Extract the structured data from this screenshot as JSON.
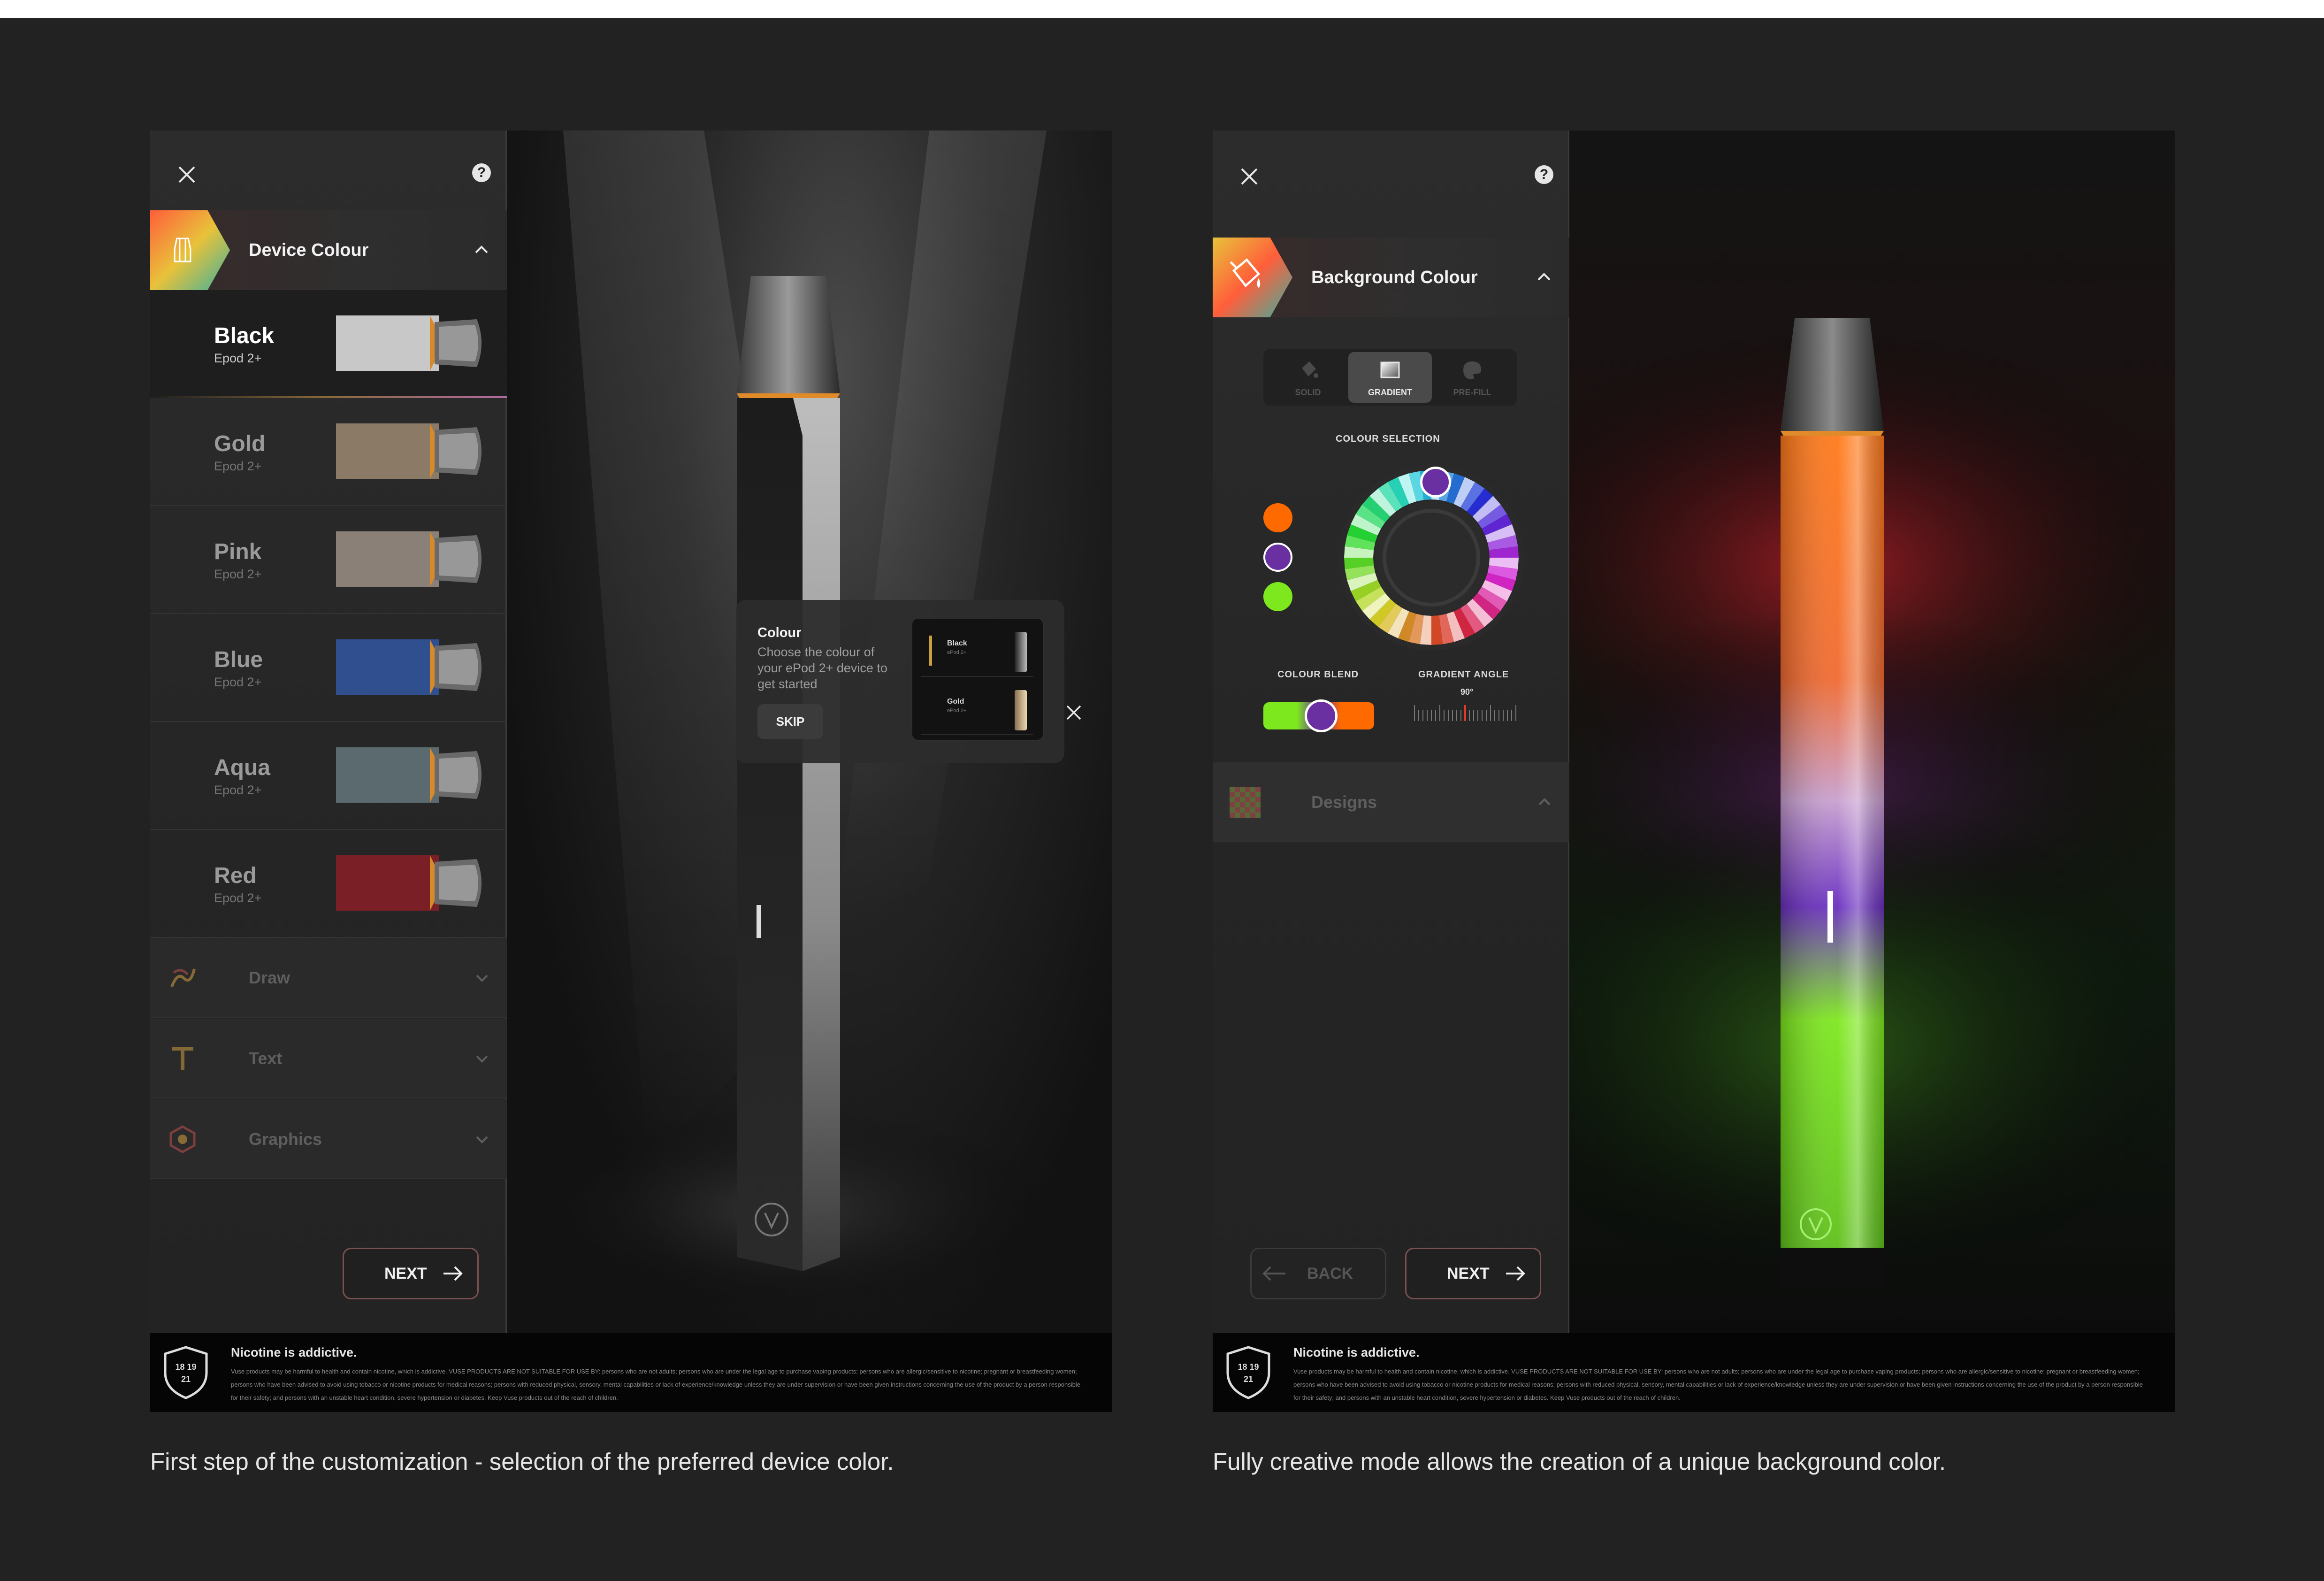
{
  "left_screen": {
    "section": {
      "title": "Device Colour"
    },
    "colors": [
      {
        "name": "Black",
        "model": "Epod 2+",
        "swatch": "#c8c8c8",
        "active": true
      },
      {
        "name": "Gold",
        "model": "Epod 2+",
        "swatch": "#8a7a66",
        "active": false
      },
      {
        "name": "Pink",
        "model": "Epod 2+",
        "swatch": "#8a8078",
        "active": false
      },
      {
        "name": "Blue",
        "model": "Epod 2+",
        "swatch": "#2f4f8f",
        "active": false
      },
      {
        "name": "Aqua",
        "model": "Epod 2+",
        "swatch": "#5a6a6e",
        "active": false
      },
      {
        "name": "Red",
        "model": "Epod 2+",
        "swatch": "#7a1f26",
        "active": false
      }
    ],
    "tools": [
      {
        "label": "Draw",
        "icon": "draw-icon"
      },
      {
        "label": "Text",
        "icon": "text-icon"
      },
      {
        "label": "Graphics",
        "icon": "graphics-icon"
      }
    ],
    "next_label": "NEXT",
    "popup": {
      "title": "Colour",
      "text": "Choose the colour of your ePod 2+ device to get started",
      "skip_label": "SKIP",
      "thumbs": [
        {
          "name": "Black",
          "sub": "ePod 2+"
        },
        {
          "name": "Gold",
          "sub": "ePod 2+"
        }
      ]
    }
  },
  "right_screen": {
    "section": {
      "title": "Background Colour"
    },
    "tabs": [
      {
        "label": "SOLID",
        "icon": "paint-bucket-icon",
        "active": false
      },
      {
        "label": "GRADIENT",
        "icon": "gradient-icon",
        "active": true
      },
      {
        "label": "PRE-FILL",
        "icon": "palette-icon",
        "active": false
      }
    ],
    "colour_selection_label": "COLOUR SELECTION",
    "selected_colors": [
      "#ff6a00",
      "#6a2fa0",
      "#7ee81e"
    ],
    "selected_index": 1,
    "colour_blend_label": "COLOUR BLEND",
    "gradient_angle_label": "GRADIENT ANGLE",
    "gradient_angle_value": "90°",
    "designs_label": "Designs",
    "back_label": "BACK",
    "next_label": "NEXT"
  },
  "warning": {
    "heading": "Nicotine is addictive.",
    "body": "Vuse products may be harmful to health and contain nicotine, which is addictive. VUSE PRODUCTS ARE NOT SUITABLE FOR USE BY: persons who are not adults; persons who are under the legal age to purchase vaping products; persons who are allergic/sensitive to nicotine; pregnant or breastfeeding women; persons who have been advised to avoid using tobacco or nicotine products for medical reasons; persons with reduced physical, sensory, mental capabilities or lack of experience/knowledge unless they are under supervision or have been given instructions concerning the use of the product by a person responsible for their safety; and persons with an unstable heart condition, severe hypertension or diabetes. Keep Vuse products out of the reach of children.",
    "age_badge": "18 19 21"
  },
  "captions": {
    "left": "First step of the customization - selection of the preferred device color.",
    "right": "Fully creative mode allows the creation of a unique background color."
  },
  "colors": {
    "background": "#222222",
    "accent_red": "#c0392b",
    "orange": "#ff6a00",
    "purple": "#6a2fa0",
    "green": "#7ee81e"
  }
}
